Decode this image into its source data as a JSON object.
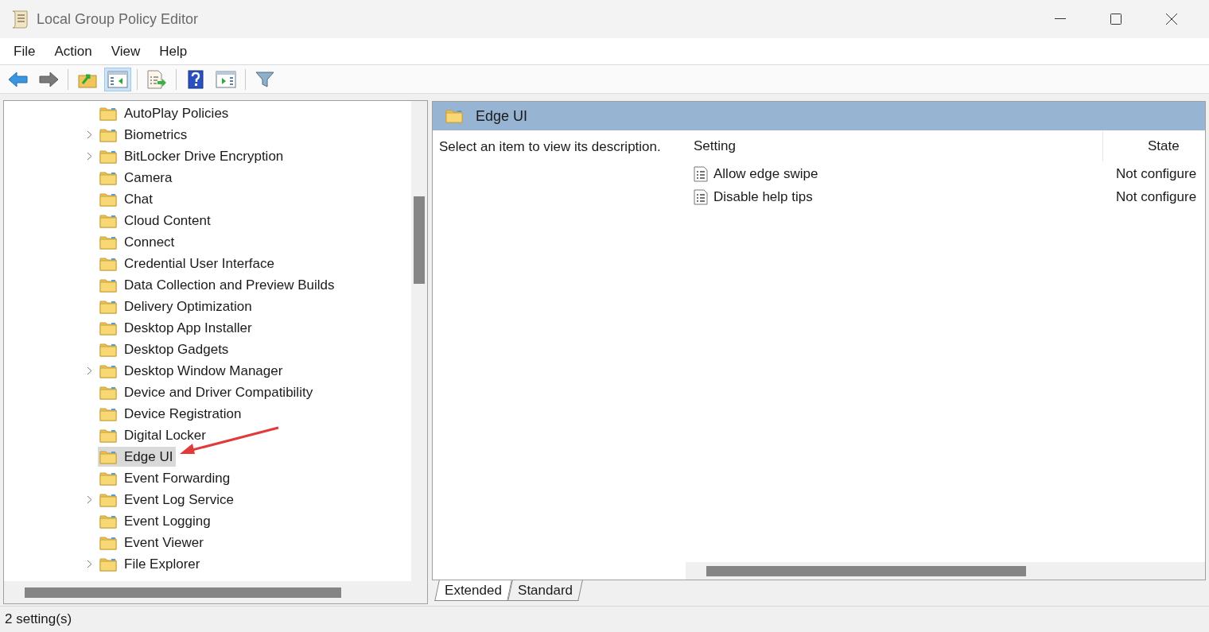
{
  "window": {
    "title": "Local Group Policy Editor"
  },
  "menu": [
    "File",
    "Action",
    "View",
    "Help"
  ],
  "toolbar": [
    {
      "kind": "back",
      "pressed": false
    },
    {
      "kind": "forward",
      "pressed": false
    },
    {
      "kind": "sep"
    },
    {
      "kind": "up",
      "pressed": false
    },
    {
      "kind": "tree",
      "pressed": true
    },
    {
      "kind": "sep"
    },
    {
      "kind": "export",
      "pressed": false
    },
    {
      "kind": "sep"
    },
    {
      "kind": "help",
      "pressed": false
    },
    {
      "kind": "action",
      "pressed": false
    },
    {
      "kind": "sep"
    },
    {
      "kind": "filter",
      "pressed": false
    }
  ],
  "tree": [
    {
      "label": "AutoPlay Policies",
      "expandable": false,
      "selected": false
    },
    {
      "label": "Biometrics",
      "expandable": true,
      "selected": false
    },
    {
      "label": "BitLocker Drive Encryption",
      "expandable": true,
      "selected": false
    },
    {
      "label": "Camera",
      "expandable": false,
      "selected": false
    },
    {
      "label": "Chat",
      "expandable": false,
      "selected": false
    },
    {
      "label": "Cloud Content",
      "expandable": false,
      "selected": false
    },
    {
      "label": "Connect",
      "expandable": false,
      "selected": false
    },
    {
      "label": "Credential User Interface",
      "expandable": false,
      "selected": false
    },
    {
      "label": "Data Collection and Preview Builds",
      "expandable": false,
      "selected": false
    },
    {
      "label": "Delivery Optimization",
      "expandable": false,
      "selected": false
    },
    {
      "label": "Desktop App Installer",
      "expandable": false,
      "selected": false
    },
    {
      "label": "Desktop Gadgets",
      "expandable": false,
      "selected": false
    },
    {
      "label": "Desktop Window Manager",
      "expandable": true,
      "selected": false
    },
    {
      "label": "Device and Driver Compatibility",
      "expandable": false,
      "selected": false
    },
    {
      "label": "Device Registration",
      "expandable": false,
      "selected": false
    },
    {
      "label": "Digital Locker",
      "expandable": false,
      "selected": false
    },
    {
      "label": "Edge UI",
      "expandable": false,
      "selected": true
    },
    {
      "label": "Event Forwarding",
      "expandable": false,
      "selected": false
    },
    {
      "label": "Event Log Service",
      "expandable": true,
      "selected": false
    },
    {
      "label": "Event Logging",
      "expandable": false,
      "selected": false
    },
    {
      "label": "Event Viewer",
      "expandable": false,
      "selected": false
    },
    {
      "label": "File Explorer",
      "expandable": true,
      "selected": false
    }
  ],
  "details": {
    "title": "Edge UI",
    "description": "Select an item to view its description.",
    "columns": [
      "Setting",
      "State"
    ],
    "rows": [
      {
        "setting": "Allow edge swipe",
        "state": "Not configure"
      },
      {
        "setting": "Disable help tips",
        "state": "Not configure"
      }
    ]
  },
  "tabs": [
    {
      "label": "Extended",
      "selected": true
    },
    {
      "label": "Standard",
      "selected": false
    }
  ],
  "status_bar": "2 setting(s)"
}
